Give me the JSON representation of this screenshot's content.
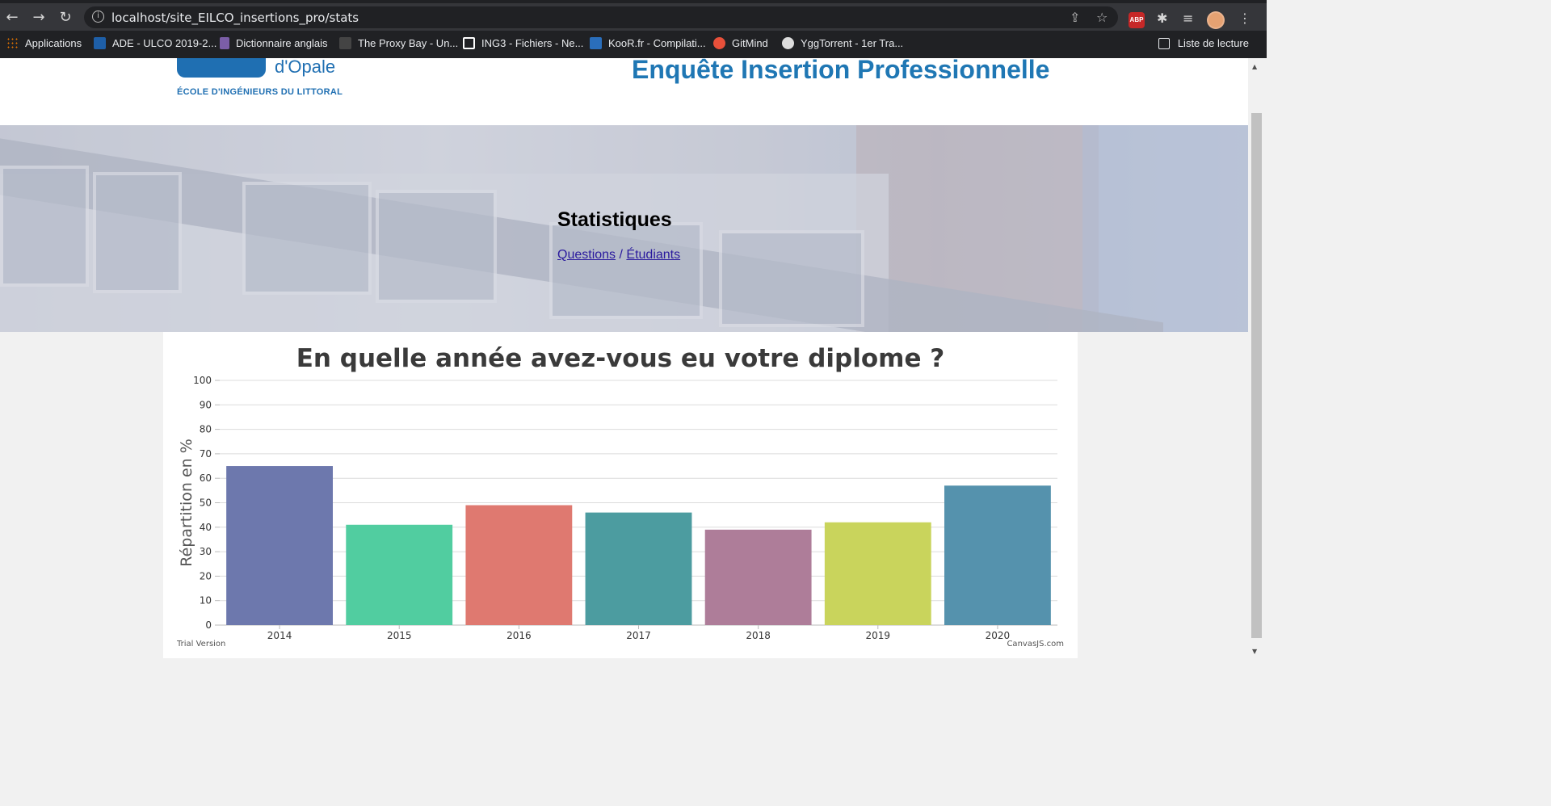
{
  "browser": {
    "url": "localhost/site_EILCO_insertions_pro/stats",
    "bookmarks": [
      {
        "label": "Applications",
        "color": "#e37400"
      },
      {
        "label": "ADE - ULCO 2019-2...",
        "color": "#1e5fa8"
      },
      {
        "label": "Dictionnaire anglais",
        "color": "#7b5ea7"
      },
      {
        "label": "The Proxy Bay - Un...",
        "color": "#444444"
      },
      {
        "label": "ING3 - Fichiers - Ne...",
        "color": "#ffffff"
      },
      {
        "label": "KooR.fr - Compilati...",
        "color": "#2a6ebb"
      },
      {
        "label": "GitMind",
        "color": "#e8503a"
      },
      {
        "label": "YggTorrent - 1er Tra...",
        "color": "#dddddd"
      }
    ],
    "reading_list": "Liste de lecture",
    "abp_label": "ABP"
  },
  "header": {
    "logo_text": "d'Opale",
    "logo_school": "ÉCOLE D'INGÉNIEURS DU LITTORAL",
    "site_title": "Enquête Insertion Professionnelle",
    "brand_color": "#1f77b4"
  },
  "banner": {
    "title": "Statistiques",
    "link_questions": "Questions",
    "separator": "/",
    "link_students": "Étudiants"
  },
  "chart_data": {
    "type": "bar",
    "title": "En quelle année avez-vous eu votre diplome ?",
    "xlabel": "",
    "ylabel": "Répartition en %",
    "ylim": [
      0,
      100
    ],
    "yticks": [
      0,
      10,
      20,
      30,
      40,
      50,
      60,
      70,
      80,
      90,
      100
    ],
    "categories": [
      "2014",
      "2015",
      "2016",
      "2017",
      "2018",
      "2019",
      "2020"
    ],
    "values": [
      65,
      41,
      49,
      46,
      39,
      42,
      57
    ],
    "colors": [
      "#6d78ad",
      "#51cda0",
      "#df7970",
      "#4c9ca0",
      "#ae7d99",
      "#c9d45c",
      "#5592ad"
    ],
    "grid": true,
    "watermark_left": "Trial Version",
    "watermark_right": "CanvasJS.com"
  }
}
